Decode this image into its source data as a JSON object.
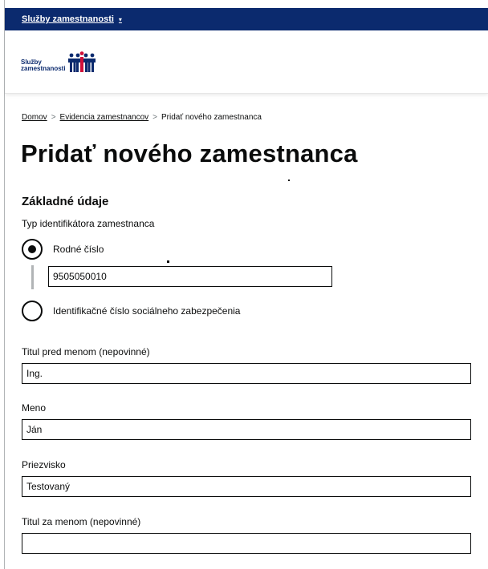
{
  "topbar": {
    "service_link": "Služby zamestnanosti",
    "caret": "▾"
  },
  "header": {
    "logo_line1": "Služby",
    "logo_line2": "zamestnanosti"
  },
  "breadcrumb": {
    "items": [
      "Domov",
      "Evidencia zamestnancov",
      "Pridať nového zamestnanca"
    ],
    "separator": ">"
  },
  "page": {
    "title": "Pridať nového zamestnanca"
  },
  "form": {
    "section_title": "Základné údaje",
    "id_type_label": "Typ identifikátora zamestnanca",
    "radio_options": [
      {
        "label": "Rodné číslo",
        "selected": true
      },
      {
        "label": "Identifikačné číslo sociálneho zabezpečenia",
        "selected": false
      }
    ],
    "rodne_cislo_value": "9505050010",
    "fields": [
      {
        "label": "Titul pred menom (nepovinné)",
        "value": "Ing."
      },
      {
        "label": "Meno",
        "value": "Ján"
      },
      {
        "label": "Priezvisko",
        "value": "Testovaný"
      },
      {
        "label": "Titul za menom (nepovinné)",
        "value": ""
      }
    ]
  },
  "colors": {
    "topbar": "#0b2a6e",
    "text": "#0b0c0c",
    "logo_blue": "#0b2a6e",
    "logo_red": "#d0103a"
  },
  "icons": [
    "chevron-down-icon",
    "logo-figures-icon"
  ]
}
